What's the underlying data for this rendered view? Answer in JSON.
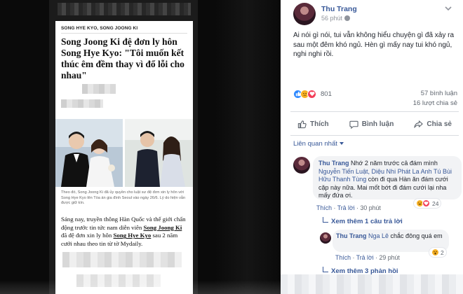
{
  "article": {
    "tags": "SONG HYE KYO, SONG JOONG KI",
    "headline": "Song Joong Ki đệ đơn ly hôn Song Hye Kyo: \"Tôi muốn kết thúc êm đềm thay vì đổ lỗi cho nhau\"",
    "caption": "Theo đó, Song Joong Ki đã ủy quyền cho luật sư đệ đơn xin ly hôn với Song Hye Kyo lên Tòa án gia đình Seoul vào ngày 26/6. Lý do hiện vẫn được giữ kín.",
    "body_1": "Sáng nay, truyền thông Hàn Quốc và thế giới chấn động trước tin tức nam diễn viên ",
    "body_name_1": "Song Joong Ki",
    "body_2": " đã đệ đơn xin ly hôn ",
    "body_name_2": "Song Hye Kyo",
    "body_3": " sau 2 năm cưới nhau theo tin từ tờ Mydaily."
  },
  "post": {
    "author": "Thu Trang",
    "time": "56 phút",
    "text": "Ai nói gì nói, tui vẫn không hiểu chuyện gì đã xảy ra sau một đêm khó ngủ. Hèn gì mấy nay tui khó ngủ, nghi nghi rồi.",
    "reaction_count": "801",
    "comments_count": "57 bình luận",
    "shares_count": "16 lượt chia sẻ"
  },
  "actions": {
    "like": "Thích",
    "comment": "Bình luận",
    "share": "Chia sẻ"
  },
  "sort_label": "Liên quan nhất",
  "comments": [
    {
      "author": "Thu Trang",
      "text_1": "Nhớ 2 năm trước cả đám mình ",
      "tags": "Nguyễn Tiến Luật, Diệu Nhi Phát La Anh Tú Bùi Hữu Thanh Tùng",
      "text_2": " còn đi qua Hàn ăn đám cưới cặp này nữa. Mai mốt bớt đi đám cưới lại nha mấy đứa ơi.",
      "like": "Thích",
      "reply": "Trả lời",
      "time": "30 phút",
      "reaction_count": "24",
      "view_replies": "Xem thêm 1 câu trả lời"
    },
    {
      "author": "Thu Trang",
      "tag": "Nga Lê",
      "text": " chắc đông quá em",
      "like": "Thích",
      "reply": "Trả lời",
      "time": "29 phút",
      "reaction_count": "2"
    }
  ],
  "more_replies": "Xem thêm 3 phản hồi",
  "colors": {
    "link": "#385898",
    "text": "#1d2129",
    "muted": "#606770",
    "like_blue": "#2d88ff",
    "love_red": "#f33e58",
    "emoji_yellow": "#f7b125"
  }
}
